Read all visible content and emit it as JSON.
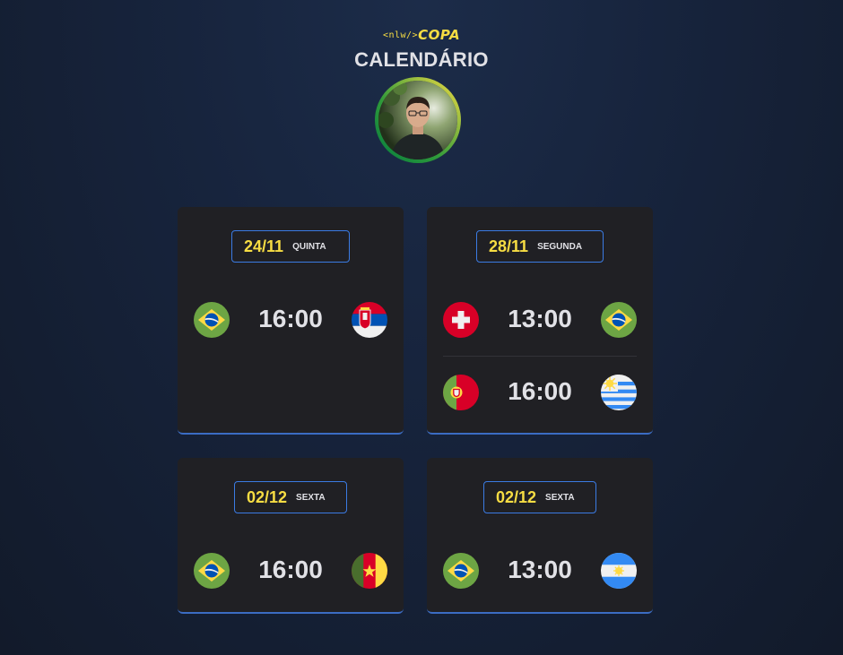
{
  "header": {
    "logo_tag": "<nlw/>",
    "logo_text": "COPA",
    "title": "CALENDÁRIO"
  },
  "colors": {
    "accent_yellow": "#f7dd43",
    "accent_blue": "#3b7be3",
    "card_bg": "#202024"
  },
  "cards": [
    {
      "date": "24/11",
      "weekday": "QUINTA",
      "matches": [
        {
          "home_flag": "brazil-flag-icon",
          "time": "16:00",
          "away_flag": "serbia-flag-icon"
        }
      ]
    },
    {
      "date": "28/11",
      "weekday": "SEGUNDA",
      "matches": [
        {
          "home_flag": "switzerland-flag-icon",
          "time": "13:00",
          "away_flag": "brazil-flag-icon"
        },
        {
          "home_flag": "portugal-flag-icon",
          "time": "16:00",
          "away_flag": "uruguay-flag-icon"
        }
      ]
    },
    {
      "date": "02/12",
      "weekday": "SEXTA",
      "matches": [
        {
          "home_flag": "brazil-flag-icon",
          "time": "16:00",
          "away_flag": "cameroon-flag-icon"
        }
      ]
    },
    {
      "date": "02/12",
      "weekday": "SEXTA",
      "matches": [
        {
          "home_flag": "brazil-flag-icon",
          "time": "13:00",
          "away_flag": "argentina-flag-icon"
        }
      ]
    }
  ]
}
